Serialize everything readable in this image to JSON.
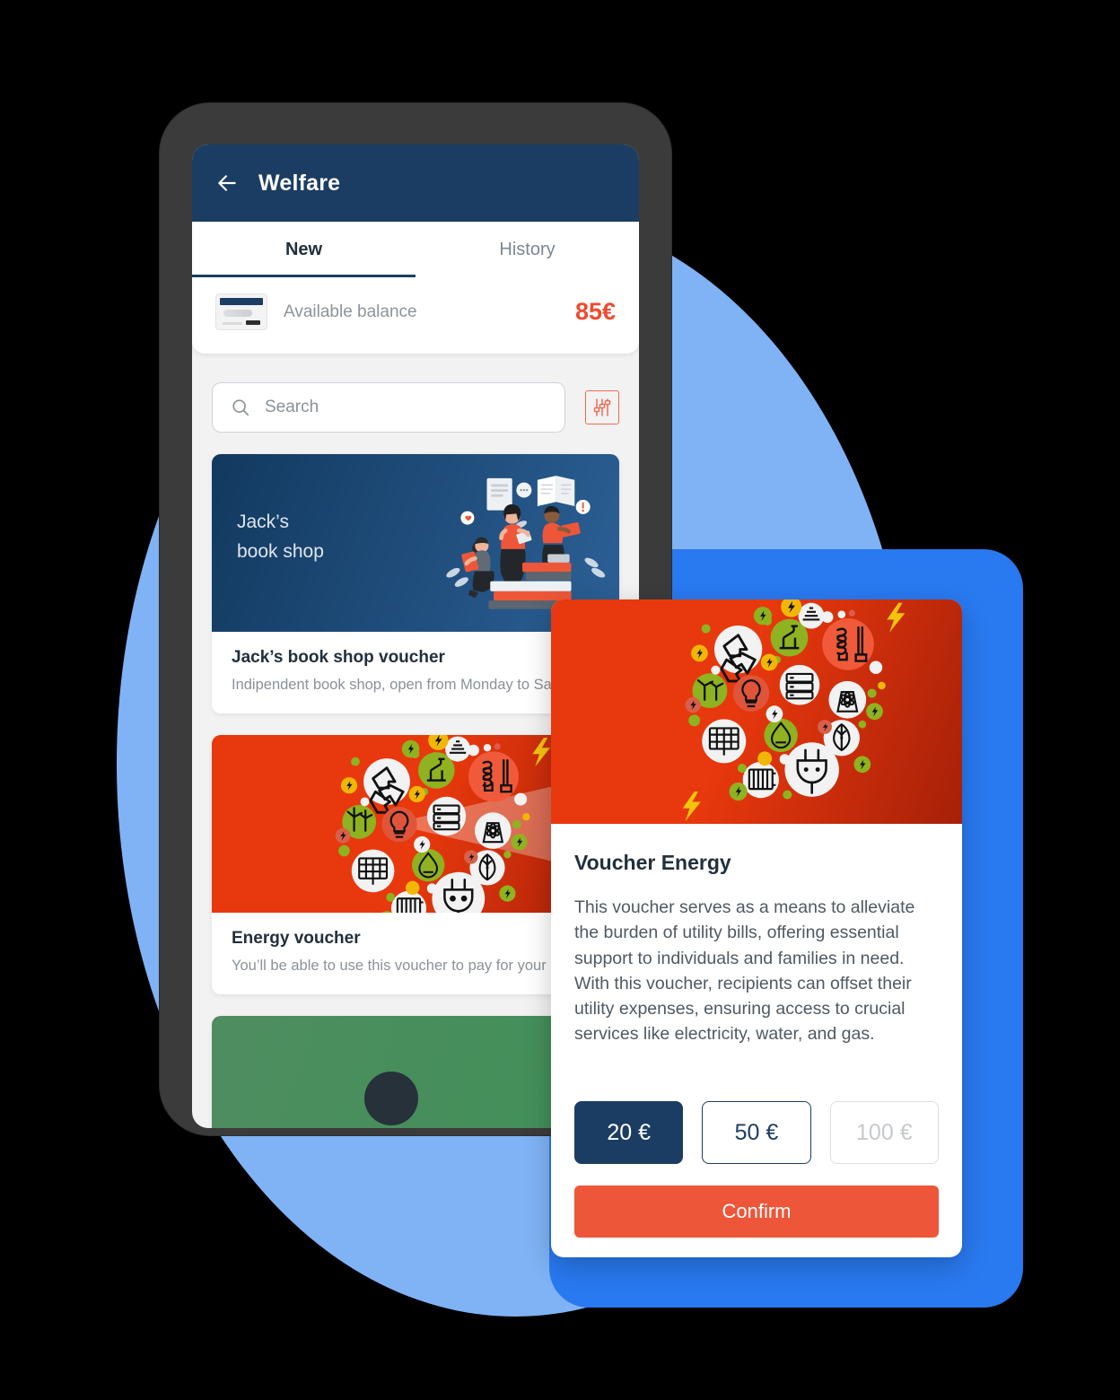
{
  "app": {
    "title": "Welfare",
    "back_icon": "arrow-left-icon"
  },
  "tabs": [
    {
      "label": "New",
      "active": true
    },
    {
      "label": "History",
      "active": false
    }
  ],
  "balance": {
    "icon": "credit-card-icon",
    "label": "Available balance",
    "amount": "85€",
    "amount_color": "#EE4C30"
  },
  "search": {
    "icon": "search-icon",
    "placeholder": "Search",
    "value": "",
    "filter_icon": "sliders-filter-icon",
    "filter_color": "#EE6B52"
  },
  "vouchers": [
    {
      "banner_label": "Jack’s\nbook shop",
      "banner_line1": "Jack’s",
      "banner_line2": "book shop",
      "title": "Jack’s book shop voucher",
      "description": "Indipendent book shop, open from Monday to Sa..",
      "banner_style": "book",
      "illustration": "people-reading-books-illustration"
    },
    {
      "banner_label": "",
      "banner_line1": "",
      "banner_line2": "",
      "title": "Energy voucher",
      "description": "You’ll be able to use this voucher to pay for your el",
      "banner_style": "energy",
      "illustration": "energy-icons-collage-illustration"
    },
    {
      "banner_label": "",
      "banner_line1": "",
      "banner_line2": "",
      "title": "",
      "description": "",
      "banner_style": "green",
      "illustration": "green-card-illustration"
    }
  ],
  "modal": {
    "banner_illustration": "energy-icons-collage-illustration",
    "title": "Voucher Energy",
    "body": "This voucher serves as a means to alleviate the burden of utility bills, offering essential support to individuals and families in need. With this voucher, recipients can offset their utility expenses, ensuring access to crucial services like electricity, water, and gas.",
    "amounts": [
      {
        "label": "20 €",
        "state": "selected"
      },
      {
        "label": "50 €",
        "state": "available"
      },
      {
        "label": "100 €",
        "state": "disabled"
      }
    ],
    "confirm_label": "Confirm"
  },
  "theme": {
    "navy": "#1C3D63",
    "coral": "#EE5639",
    "red": "#E8380D",
    "light_blue": "#7FB3F5",
    "bright_blue": "#2979F0",
    "green": "#4F8D60"
  }
}
